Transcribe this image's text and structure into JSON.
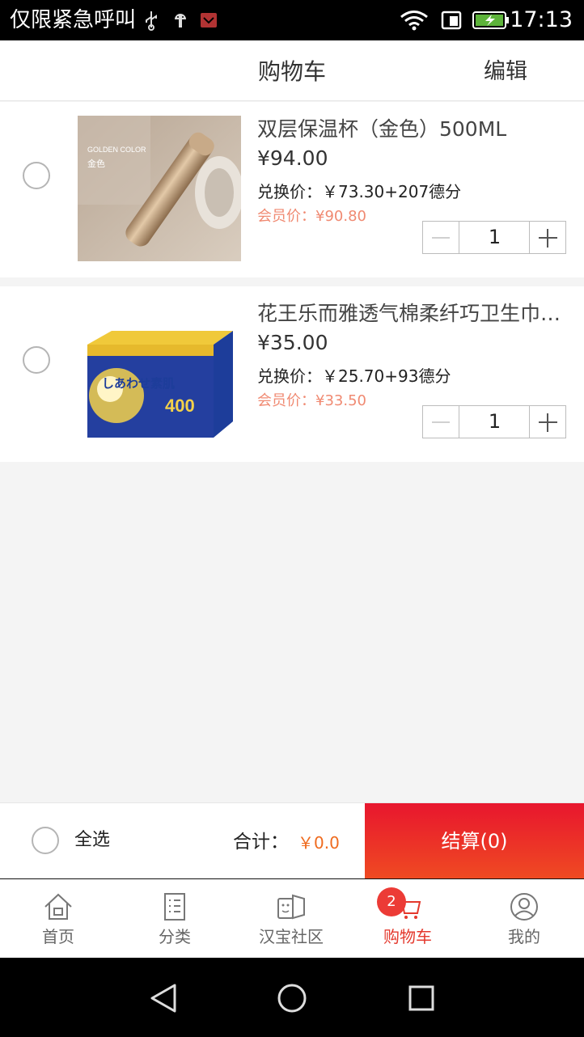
{
  "status_bar": {
    "carrier": "仅限紧急呼叫",
    "time": "17:13",
    "icons": [
      "usb-icon",
      "android-debug-icon",
      "notification-icon",
      "wifi-icon",
      "sim-icon",
      "battery-charging-icon"
    ]
  },
  "header": {
    "title": "购物车",
    "edit_label": "编辑"
  },
  "cart_items": [
    {
      "name": "双层保温杯（金色）500ML",
      "price": "¥94.00",
      "exchange_price": "兑换价：￥73.30+207德分",
      "member_price": "会员价：¥90.80",
      "quantity": "1",
      "image_caption": "GOLDEN COLOR",
      "image_caption_cn": "金色"
    },
    {
      "name": "花王乐而雅透气棉柔纤巧卫生巾…",
      "price": "¥35.00",
      "exchange_price": "兑换价：￥25.70+93德分",
      "member_price": "会员价：¥33.50",
      "quantity": "1",
      "image_caption": "しあわせ素肌",
      "image_count": "400"
    }
  ],
  "checkout": {
    "select_all_label": "全选",
    "total_label": "合计：",
    "total_value": "￥0.0",
    "checkout_button": "结算(0)",
    "accent_color": "#e8162e"
  },
  "tabbar": {
    "tabs": [
      {
        "label": "首页",
        "icon": "home-icon"
      },
      {
        "label": "分类",
        "icon": "category-list-icon"
      },
      {
        "label": "汉宝社区",
        "icon": "community-icon"
      },
      {
        "label": "购物车",
        "icon": "cart-icon",
        "badge": "2",
        "active": true
      },
      {
        "label": "我的",
        "icon": "profile-icon"
      }
    ],
    "active_color": "#e4392d"
  },
  "system_nav": {
    "buttons": [
      "back-icon",
      "home-circle-icon",
      "recents-icon"
    ]
  }
}
